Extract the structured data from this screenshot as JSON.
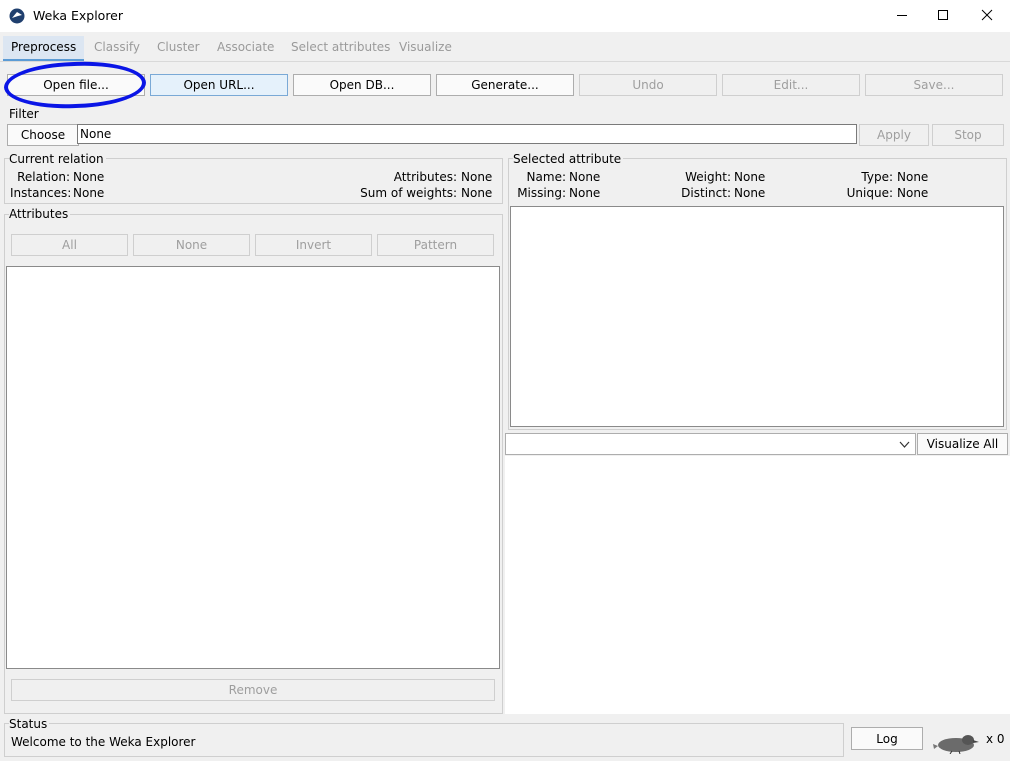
{
  "window": {
    "title": "Weka Explorer",
    "controls": [
      "minimize",
      "maximize",
      "close"
    ]
  },
  "tabs": [
    {
      "label": "Preprocess",
      "active": true
    },
    {
      "label": "Classify",
      "active": false
    },
    {
      "label": "Cluster",
      "active": false
    },
    {
      "label": "Associate",
      "active": false
    },
    {
      "label": "Select attributes",
      "active": false
    },
    {
      "label": "Visualize",
      "active": false
    }
  ],
  "toolbar": {
    "open_file": "Open file...",
    "open_url": "Open URL...",
    "open_db": "Open DB...",
    "generate": "Generate...",
    "undo": "Undo",
    "edit": "Edit...",
    "save": "Save..."
  },
  "filter": {
    "label": "Filter",
    "choose": "Choose",
    "value": "None",
    "apply": "Apply",
    "stop": "Stop"
  },
  "current_relation": {
    "label": "Current relation",
    "relation_label": "Relation:",
    "relation_value": "None",
    "instances_label": "Instances:",
    "instances_value": "None",
    "attributes_label": "Attributes:",
    "attributes_value": "None",
    "sum_weights_label": "Sum of weights:",
    "sum_weights_value": "None"
  },
  "attributes": {
    "label": "Attributes",
    "all": "All",
    "none": "None",
    "invert": "Invert",
    "pattern": "Pattern",
    "remove": "Remove"
  },
  "selected_attribute": {
    "label": "Selected attribute",
    "name_label": "Name:",
    "name_value": "None",
    "missing_label": "Missing:",
    "missing_value": "None",
    "weight_label": "Weight:",
    "weight_value": "None",
    "distinct_label": "Distinct:",
    "distinct_value": "None",
    "type_label": "Type:",
    "type_value": "None",
    "unique_label": "Unique:",
    "unique_value": "None"
  },
  "visualize": {
    "class_select_value": "",
    "visualize_all": "Visualize All"
  },
  "status": {
    "label": "Status",
    "message": "Welcome to the Weka Explorer",
    "log": "Log",
    "count": "x 0"
  },
  "colors": {
    "annotation_circle": "#0a15e6",
    "active_tab_underline": "#5b9bd5",
    "background": "#f0f0f0"
  },
  "icons": [
    "weka-app-icon",
    "minimize-icon",
    "maximize-icon",
    "close-icon",
    "chevron-down-icon",
    "weka-bird-icon"
  ]
}
